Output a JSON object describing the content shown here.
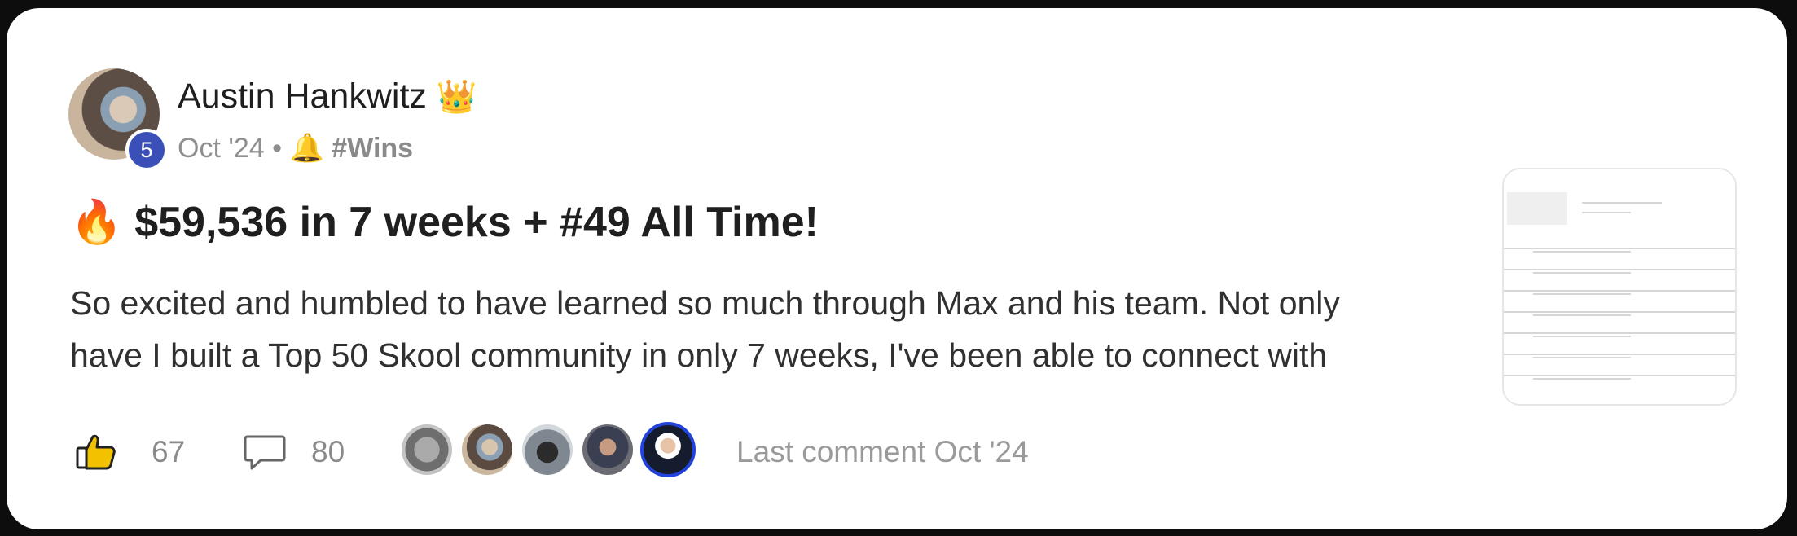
{
  "post": {
    "author": "Austin Hankwitz",
    "author_badge_icon": "crown-icon",
    "level": "5",
    "date": "Oct '24",
    "separator": "•",
    "category_icon": "bell-icon",
    "category": "#Wins",
    "title": "$59,536 in 7 weeks + #49 All Time!",
    "title_icon": "fire-icon",
    "body_lines": [
      "So excited and humbled to have learned so much through Max and his team. Not only",
      "have I built a Top 50 Skool community in only 7 weeks, I've been able to connect with"
    ]
  },
  "footer": {
    "likes": "67",
    "comments": "80",
    "last_comment": "Last comment Oct '24"
  },
  "colors": {
    "level_badge": "#3b4fb8",
    "muted_text": "#8a8a8a",
    "commenter_highlight": "#2244dd"
  }
}
